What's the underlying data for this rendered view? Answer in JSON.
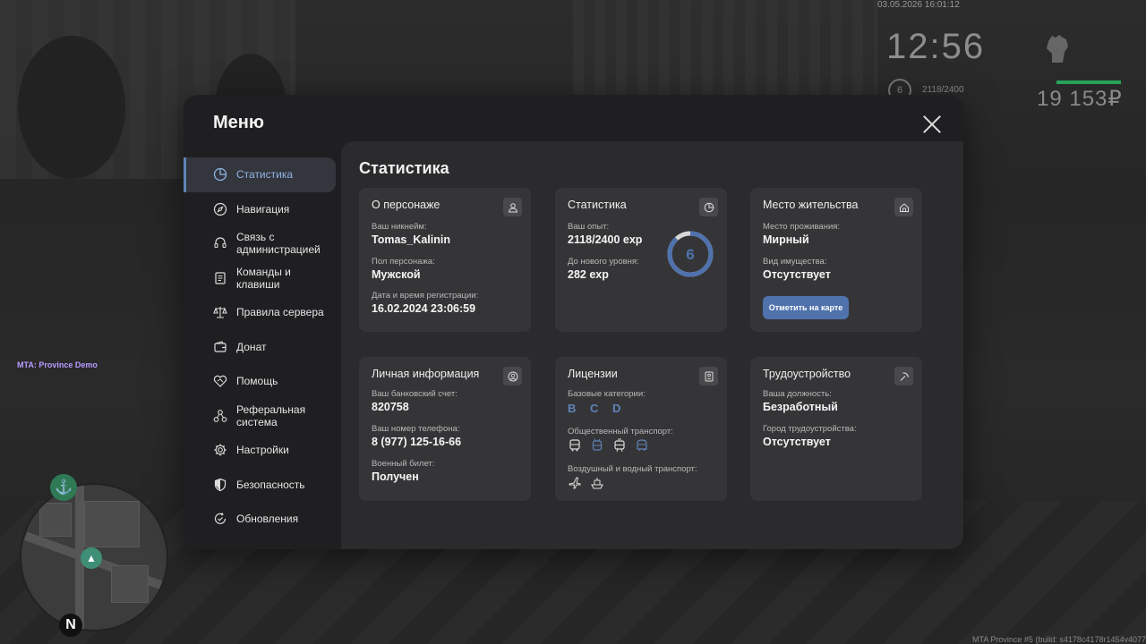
{
  "hud": {
    "date": "03.05.2026 16:01:12",
    "time": "12:56",
    "level": "6",
    "exp": "2118/2400",
    "money": "19 153₽",
    "fist_icon": "fist-icon"
  },
  "mta_label": "MTA: Province Demo",
  "build_label": "MTA Province #5 (build: s4178c4178r1454v4077",
  "minimap": {
    "north": "N"
  },
  "menu": {
    "title": "Меню",
    "sidebar": [
      {
        "label": "Статистика",
        "icon": "pie-chart-icon",
        "active": true
      },
      {
        "label": "Навигация",
        "icon": "compass-icon"
      },
      {
        "label": "Связь с администрацией",
        "icon": "headset-icon"
      },
      {
        "label": "Команды и клавиши",
        "icon": "keyboard-icon"
      },
      {
        "label": "Правила сервера",
        "icon": "scales-icon"
      },
      {
        "label": "Донат",
        "icon": "wallet-icon"
      },
      {
        "label": "Помощь",
        "icon": "heart-handshake-icon"
      },
      {
        "label": "Реферальная система",
        "icon": "referral-icon"
      },
      {
        "label": "Настройки",
        "icon": "gear-icon"
      },
      {
        "label": "Безопасность",
        "icon": "shield-icon"
      },
      {
        "label": "Обновления",
        "icon": "refresh-check-icon"
      }
    ],
    "content_title": "Статистика",
    "cards": {
      "character": {
        "title": "О персонаже",
        "nickname_label": "Ваш никнейм:",
        "nickname": "Tomas_Kalinin",
        "gender_label": "Пол персонажа:",
        "gender": "Мужской",
        "reg_label": "Дата и время регистрации:",
        "reg": "16.02.2024 23:06:59"
      },
      "stats": {
        "title": "Статистика",
        "exp_label": "Ваш опыт:",
        "exp": "2118/2400 exp",
        "next_label": "До нового уровня:",
        "next": "282 exp",
        "level": "6",
        "progress": 0.8825
      },
      "residence": {
        "title": "Место жительства",
        "place_label": "Место проживания:",
        "place": "Мирный",
        "property_label": "Вид имущества:",
        "property": "Отсутствует",
        "map_button": "Отметить на карте"
      },
      "personal": {
        "title": "Личная информация",
        "bank_label": "Ваш банковский счет:",
        "bank": "820758",
        "phone_label": "Ваш номер телефона:",
        "phone": "8 (977) 125-16-66",
        "military_label": "Военный билет:",
        "military": "Получен"
      },
      "licenses": {
        "title": "Лицензии",
        "base_label": "Базовые категории:",
        "base": "B C D",
        "public_label": "Общественный транспорт:",
        "air_label": "Воздушный и водный транспорт:"
      },
      "employment": {
        "title": "Трудоустройство",
        "position_label": "Ваша должность:",
        "position": "Безработный",
        "city_label": "Город трудоустройства:",
        "city": "Отсутствует"
      }
    }
  },
  "colors": {
    "accent": "#5f83b8",
    "button": "#4f72ad",
    "panel": "#353537",
    "menu": "#1f1f21"
  }
}
